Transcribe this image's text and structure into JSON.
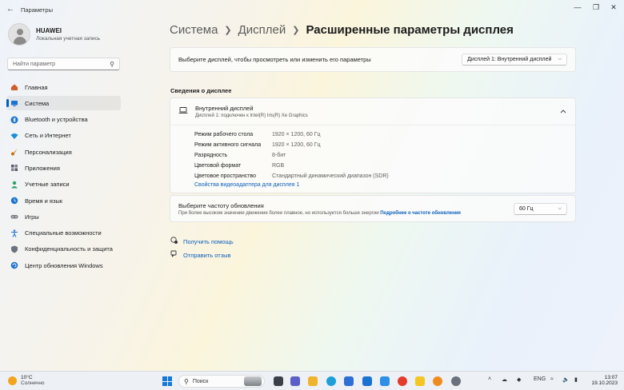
{
  "window": {
    "title": "Параметры",
    "back_icon": "arrow-left-icon",
    "controls": [
      "minimize-icon",
      "maximize-icon",
      "close-icon"
    ]
  },
  "profile": {
    "name": "HUAWEI",
    "account": "Локальная учетная запись"
  },
  "search": {
    "placeholder": "Найти параметр"
  },
  "sidebar": {
    "items": [
      {
        "label": "Главная",
        "icon": "home-icon",
        "color": "#d25c2c"
      },
      {
        "label": "Система",
        "icon": "system-icon",
        "color": "#1a73d1",
        "active": true
      },
      {
        "label": "Bluetooth и устройства",
        "icon": "bluetooth-icon",
        "color": "#1a73d1"
      },
      {
        "label": "Сеть и Интернет",
        "icon": "wifi-icon",
        "color": "#1a8fd6"
      },
      {
        "label": "Персонализация",
        "icon": "brush-icon",
        "color": "#e08a1e"
      },
      {
        "label": "Приложения",
        "icon": "apps-icon",
        "color": "#555a66"
      },
      {
        "label": "Учетные записи",
        "icon": "person-icon",
        "color": "#2aa36b"
      },
      {
        "label": "Время и язык",
        "icon": "globe-clock-icon",
        "color": "#1a73d1"
      },
      {
        "label": "Игры",
        "icon": "gamepad-icon",
        "color": "#7b8089"
      },
      {
        "label": "Специальные возможности",
        "icon": "accessibility-icon",
        "color": "#1a73d1"
      },
      {
        "label": "Конфиденциальность и защита",
        "icon": "shield-icon",
        "color": "#6b7280"
      },
      {
        "label": "Центр обновления Windows",
        "icon": "update-icon",
        "color": "#1a73d1"
      }
    ]
  },
  "breadcrumb": {
    "items": [
      "Система",
      "Дисплей"
    ],
    "current": "Расширенные параметры дисплея"
  },
  "display_selector": {
    "label": "Выберите дисплей, чтобы просмотреть или изменить его параметры",
    "value": "Дисплей 1: Внутренний дисплей"
  },
  "section_title": "Сведения о дисплее",
  "display_info": {
    "title": "Внутренний дисплей",
    "subtitle": "Дисплей 1: подключен к Intel(R) Iris(R) Xe Graphics",
    "properties": [
      {
        "key": "Режим рабочего стола",
        "value": "1920 × 1200, 60 Гц"
      },
      {
        "key": "Режим активного сигнала",
        "value": "1920 × 1200, 60 Гц"
      },
      {
        "key": "Разрядность",
        "value": "8-бит"
      },
      {
        "key": "Цветовой формат",
        "value": "RGB"
      },
      {
        "key": "Цветовое пространство",
        "value": "Стандартный динамический диапазон (SDR)"
      }
    ],
    "adapter_link": "Свойства видеоадаптера для дисплея 1"
  },
  "refresh_rate": {
    "title": "Выберите частоту обновления",
    "description": "При более высоком значении движение более плавное, но используется больше энергии",
    "link": "Подробнее о частоте обновления",
    "value": "60 Гц"
  },
  "help": {
    "get_help": "Получить помощь",
    "feedback": "Отправить отзыв"
  },
  "taskbar": {
    "weather_temp": "10°C",
    "weather_condition": "Солнечно",
    "search_label": "Поиск",
    "apps": [
      {
        "icon": "file-explorer-icon",
        "color": "#f1b22c"
      },
      {
        "icon": "edge-icon",
        "color": "#1e9fd8"
      },
      {
        "icon": "store-icon",
        "color": "#2d6fd6"
      },
      {
        "icon": "chat-icon",
        "color": "#5b5fc7"
      },
      {
        "icon": "yandex-icon",
        "color": "#e23b2e"
      },
      {
        "icon": "settings-icon",
        "color": "#6a717d"
      }
    ],
    "language": "ENG",
    "time": "13:07",
    "date": "19.10.2023"
  }
}
